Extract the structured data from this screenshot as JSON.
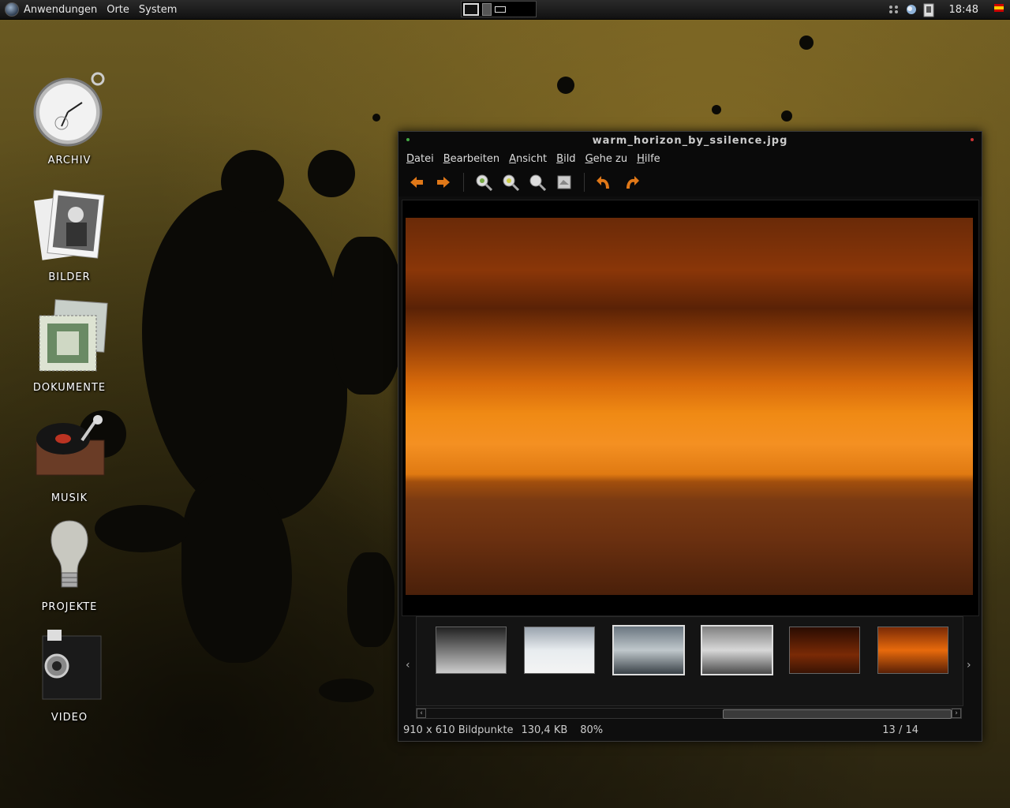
{
  "panel": {
    "menus": [
      "Anwendungen",
      "Orte",
      "System"
    ],
    "clock": "18:48",
    "tray_icons": [
      "network-icon",
      "weather-icon",
      "clipboard-icon",
      "flag-icon"
    ]
  },
  "desktop": {
    "icons": [
      {
        "label": "ARCHIV",
        "icon": "pocket-watch-icon"
      },
      {
        "label": "BILDER",
        "icon": "photos-icon"
      },
      {
        "label": "DOKUMENTE",
        "icon": "stamps-icon"
      },
      {
        "label": "MUSIK",
        "icon": "gramophone-icon"
      },
      {
        "label": "PROJEKTE",
        "icon": "lightbulb-icon"
      },
      {
        "label": "VIDEO",
        "icon": "camera-icon"
      }
    ]
  },
  "window": {
    "title": "warm_horizon_by_ssilence.jpg",
    "menus": [
      "Datei",
      "Bearbeiten",
      "Ansicht",
      "Bild",
      "Gehe zu",
      "Hilfe"
    ],
    "toolbar": [
      "back-arrow-icon",
      "forward-arrow-icon",
      "zoom-in-icon",
      "zoom-out-icon",
      "zoom-normal-icon",
      "zoom-fit-icon",
      "rotate-left-icon",
      "rotate-right-icon"
    ],
    "status": {
      "dimensions": "910 x 610 Bildpunkte",
      "size": "130,4 KB",
      "zoom": "80%",
      "position": "13 / 14"
    },
    "thumbnail_count": 6,
    "selected_thumbnails": [
      2,
      3
    ]
  }
}
